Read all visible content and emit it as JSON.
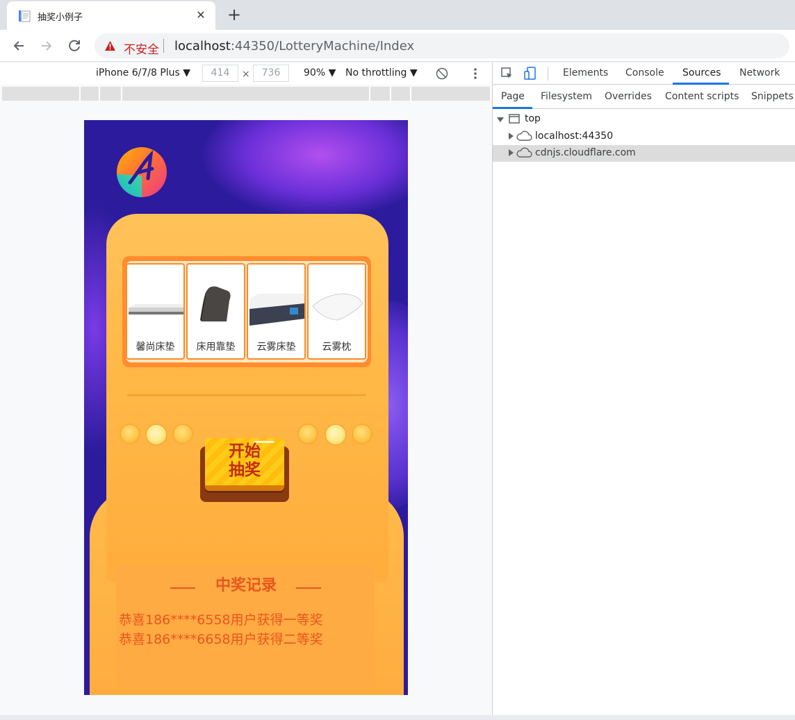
{
  "browser": {
    "tab_title": "抽奖小例子",
    "close_symbol": "✕",
    "newtab_symbol": "+",
    "security_label": "不安全",
    "url_host": "localhost",
    "url_path": ":44350/LotteryMachine/Index"
  },
  "device_toolbar": {
    "device": "iPhone 6/7/8 Plus ▼",
    "width": "414",
    "height": "736",
    "times": "×",
    "zoom": "90% ▼",
    "throttling": "No throttling ▼"
  },
  "app": {
    "prizes": [
      "馨尚床垫",
      "床用靠垫",
      "云雾床垫",
      "云雾枕"
    ],
    "start_button_line1": "开始",
    "start_button_line2": "抽奖",
    "records_title": "中奖记录",
    "records": [
      "恭喜186****6558用户获得一等奖",
      "恭喜186****6658用户获得二等奖"
    ]
  },
  "devtools": {
    "tabs": [
      "Elements",
      "Console",
      "Sources",
      "Network"
    ],
    "active_tab": "Sources",
    "subtabs": [
      "Page",
      "Filesystem",
      "Overrides",
      "Content scripts",
      "Snippets"
    ],
    "active_subtab": "Page",
    "tree": {
      "root": "top",
      "children": [
        "localhost:44350",
        "cdnjs.cloudflare.com"
      ],
      "selected": "cdnjs.cloudflare.com"
    }
  },
  "colors": {
    "accent": "#1a73e8",
    "insecure": "#c5221f",
    "machine": "#ffb947",
    "record_text": "#e8561c",
    "background_purple": "#2c1b9c"
  }
}
